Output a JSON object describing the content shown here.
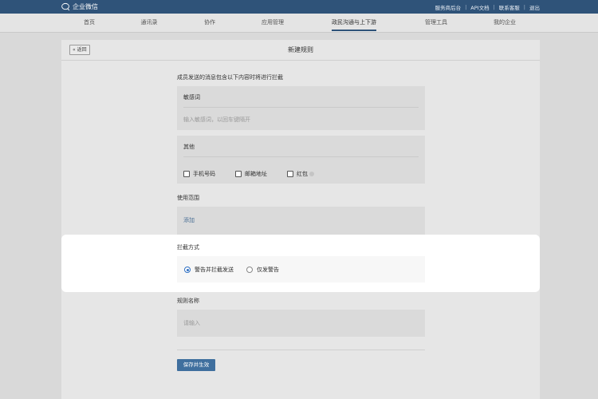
{
  "app": {
    "logo_text": "企业微信",
    "top_links": [
      "服务商后台",
      "API文档",
      "联系客服",
      "退出"
    ]
  },
  "nav": {
    "items": [
      "首页",
      "通讯录",
      "协作",
      "应用管理",
      "政民沟通与上下游",
      "管理工具",
      "我的企业"
    ],
    "active_index": 4
  },
  "page": {
    "back_label": "« 返回",
    "title": "新建规则",
    "intro": "成员发送的消息包含以下内容时将进行拦截",
    "sensitive": {
      "title": "敏感词",
      "placeholder": "输入敏感词，以回车键隔开"
    },
    "other": {
      "title": "其他",
      "options": [
        {
          "label": "手机号码",
          "checked": false
        },
        {
          "label": "邮箱地址",
          "checked": false
        },
        {
          "label": "红包",
          "checked": false
        }
      ]
    },
    "scope": {
      "label": "使用范围",
      "add_label": "添加"
    },
    "method": {
      "label": "拦截方式",
      "options": [
        {
          "label": "警告并拦截发送",
          "checked": true
        },
        {
          "label": "仅发警告",
          "checked": false
        }
      ]
    },
    "rule_name": {
      "label": "规则名称",
      "placeholder": "请输入"
    },
    "save_label": "保存并生效"
  },
  "colors": {
    "topbar": "#2f5379",
    "accent": "#3f6f9e",
    "radio_selected": "#2f6fc2"
  }
}
